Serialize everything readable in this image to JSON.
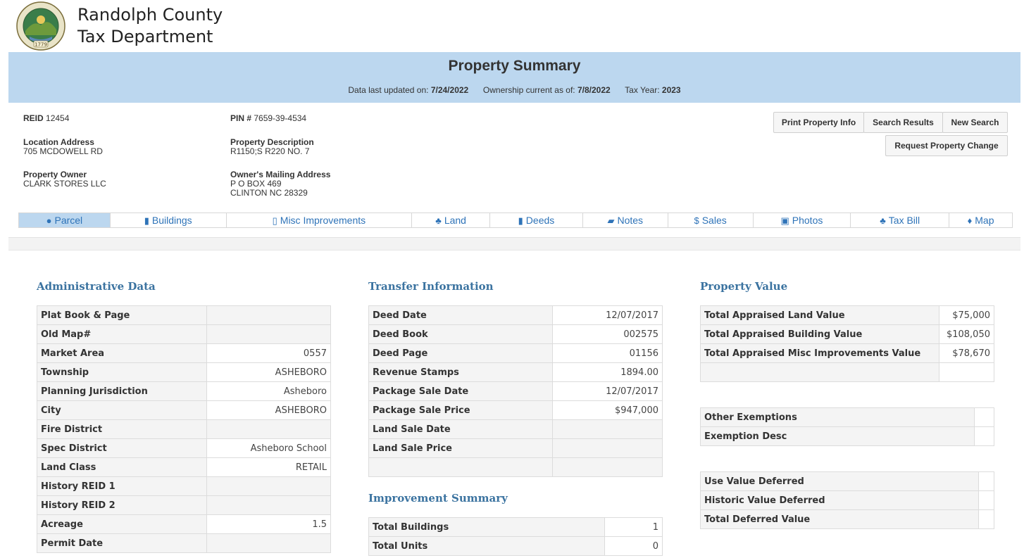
{
  "header": {
    "brand_line1": "Randolph County",
    "brand_line2": "Tax Department",
    "seal_year": "1779",
    "seal_text": "RANDOLPH COUNTY, NORTH CAROLINA"
  },
  "banner": {
    "title": "Property Summary",
    "updated_label": "Data last updated on:",
    "updated_value": "7/24/2022",
    "ownership_label": "Ownership current as of:",
    "ownership_value": "7/8/2022",
    "taxyear_label": "Tax Year:",
    "taxyear_value": "2023"
  },
  "property": {
    "reid_label": "REID",
    "reid_value": "12454",
    "pin_label": "PIN #",
    "pin_value": "7659-39-4534",
    "location_label": "Location Address",
    "location_value": "705 MCDOWELL RD",
    "description_label": "Property Description",
    "description_value": "R1150;S R220 NO. 7",
    "owner_label": "Property Owner",
    "owner_value": "CLARK STORES LLC",
    "mailing_label": "Owner's Mailing Address",
    "mailing_line1": "P O BOX 469",
    "mailing_line2": "CLINTON NC 28329"
  },
  "buttons": {
    "print": "Print Property Info",
    "search_results": "Search Results",
    "new_search": "New Search",
    "request_change": "Request Property Change"
  },
  "tabs": [
    {
      "label": "Parcel",
      "icon": "globe-icon",
      "glyph": "●"
    },
    {
      "label": "Buildings",
      "icon": "building-icon",
      "glyph": "▮"
    },
    {
      "label": "Misc Improvements",
      "icon": "building-outline-icon",
      "glyph": "▯"
    },
    {
      "label": "Land",
      "icon": "tree-icon",
      "glyph": "♣"
    },
    {
      "label": "Deeds",
      "icon": "file-icon",
      "glyph": "▮"
    },
    {
      "label": "Notes",
      "icon": "book-icon",
      "glyph": "▰"
    },
    {
      "label": "Sales",
      "icon": "dollar-icon",
      "glyph": "$"
    },
    {
      "label": "Photos",
      "icon": "picture-icon",
      "glyph": "▣"
    },
    {
      "label": "Tax Bill",
      "icon": "tree-icon",
      "glyph": "♣"
    },
    {
      "label": "Map",
      "icon": "map-marker-icon",
      "glyph": "♦"
    }
  ],
  "admin": {
    "title": "Administrative Data",
    "rows": [
      {
        "label": "Plat Book & Page",
        "value": ""
      },
      {
        "label": "Old Map#",
        "value": ""
      },
      {
        "label": "Market Area",
        "value": "0557"
      },
      {
        "label": "Township",
        "value": "ASHEBORO"
      },
      {
        "label": "Planning Jurisdiction",
        "value": "Asheboro"
      },
      {
        "label": "City",
        "value": "ASHEBORO"
      },
      {
        "label": "Fire District",
        "value": ""
      },
      {
        "label": "Spec District",
        "value": "Asheboro School"
      },
      {
        "label": "Land Class",
        "value": "RETAIL"
      },
      {
        "label": "History REID 1",
        "value": ""
      },
      {
        "label": "History REID 2",
        "value": ""
      },
      {
        "label": "Acreage",
        "value": "1.5"
      },
      {
        "label": "Permit Date",
        "value": ""
      }
    ]
  },
  "transfer": {
    "title": "Transfer Information",
    "rows": [
      {
        "label": "Deed Date",
        "value": "12/07/2017"
      },
      {
        "label": "Deed Book",
        "value": "002575"
      },
      {
        "label": "Deed Page",
        "value": "01156"
      },
      {
        "label": "Revenue Stamps",
        "value": "1894.00"
      },
      {
        "label": "Package Sale Date",
        "value": "12/07/2017"
      },
      {
        "label": "Package Sale Price",
        "value": "$947,000"
      },
      {
        "label": "Land Sale Date",
        "value": ""
      },
      {
        "label": "Land Sale Price",
        "value": ""
      },
      {
        "label": "",
        "value": ""
      }
    ]
  },
  "improvement": {
    "title": "Improvement Summary",
    "rows": [
      {
        "label": "Total Buildings",
        "value": "1"
      },
      {
        "label": "Total Units",
        "value": "0"
      }
    ]
  },
  "value": {
    "title": "Property Value",
    "rows": [
      {
        "label": "Total Appraised Land Value",
        "value": "$75,000"
      },
      {
        "label": "Total Appraised Building Value",
        "value": "$108,050"
      },
      {
        "label": "Total Appraised Misc Improvements Value",
        "value": "$78,670"
      },
      {
        "label": "",
        "value": ""
      }
    ]
  },
  "exemptions": {
    "rows": [
      {
        "label": "Other Exemptions",
        "value": ""
      },
      {
        "label": "Exemption Desc",
        "value": ""
      }
    ]
  },
  "deferred": {
    "rows": [
      {
        "label": "Use Value Deferred",
        "value": ""
      },
      {
        "label": "Historic Value Deferred",
        "value": ""
      },
      {
        "label": "Total Deferred Value",
        "value": ""
      }
    ]
  }
}
